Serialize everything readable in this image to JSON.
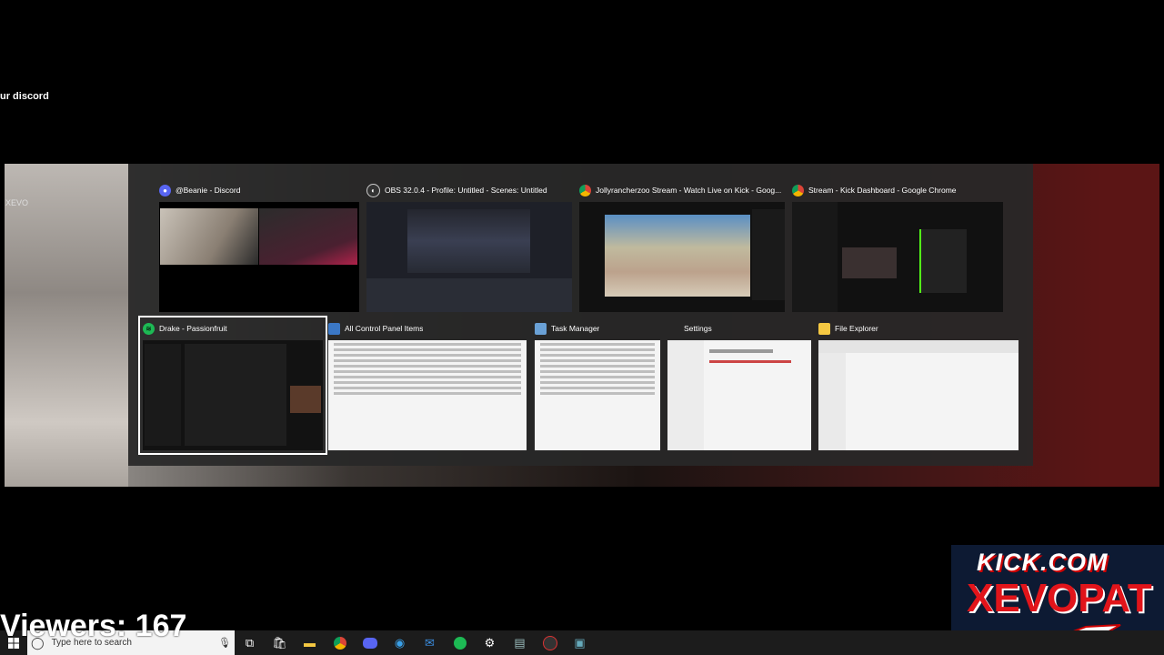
{
  "overlay": {
    "discord_text": "ur discord",
    "side_label": "XEVO",
    "viewers": "Viewers: 167"
  },
  "switcher": {
    "windows": [
      {
        "title": "@Beanie - Discord",
        "icon": "discord-icon"
      },
      {
        "title": "OBS 32.0.4 - Profile: Untitled - Scenes: Untitled",
        "icon": "obs-icon"
      },
      {
        "title": "Jollyrancherzoo Stream - Watch Live on Kick - Goog...",
        "icon": "chrome-icon"
      },
      {
        "title": "Stream - Kick Dashboard - Google Chrome",
        "icon": "chrome-icon"
      },
      {
        "title": "Drake - Passionfruit",
        "icon": "spotify-icon"
      },
      {
        "title": "All Control Panel Items",
        "icon": "control-panel-icon"
      },
      {
        "title": "Task Manager",
        "icon": "task-manager-icon"
      },
      {
        "title": "Settings",
        "icon": "settings-icon"
      },
      {
        "title": "File Explorer",
        "icon": "folder-icon"
      }
    ]
  },
  "taskbar": {
    "search_placeholder": "Type here to search",
    "apps": [
      "task-view-icon",
      "store-icon",
      "file-explorer-icon",
      "chrome-icon",
      "discord-icon",
      "edge-icon",
      "mail-icon",
      "spotify-icon",
      "settings-icon",
      "control-panel-icon",
      "obs-icon",
      "remote-icon"
    ]
  },
  "kick_logo": {
    "line1": "KICK.COM",
    "line2": "XEVOPAT"
  }
}
